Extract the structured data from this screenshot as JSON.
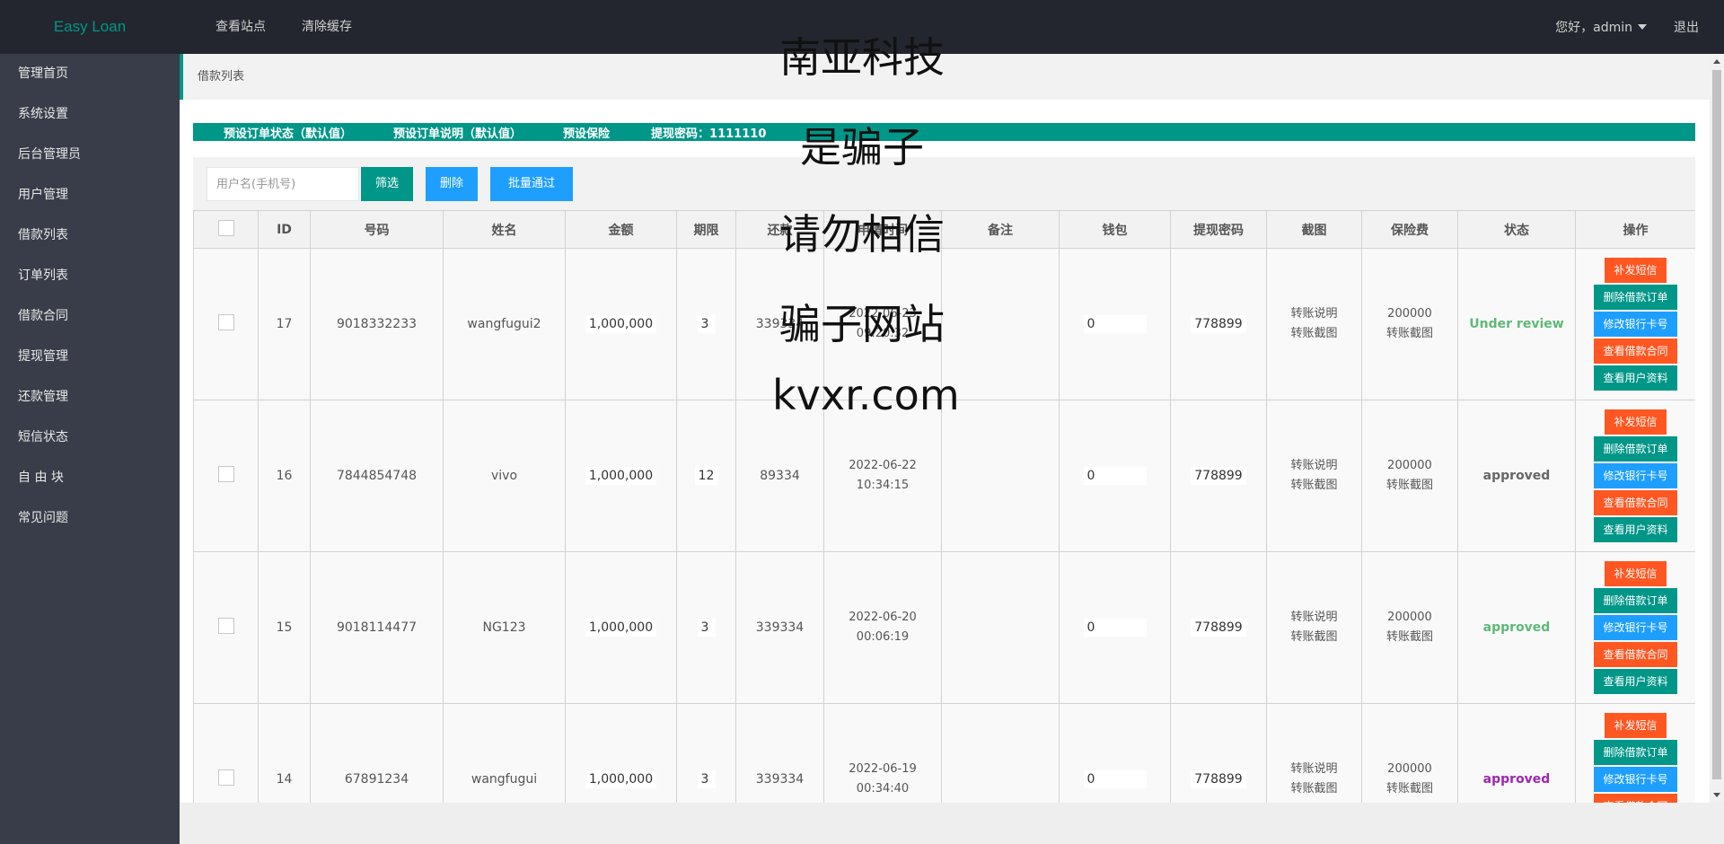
{
  "header": {
    "logo": "Easy Loan",
    "nav": [
      "查看站点",
      "清除缓存"
    ],
    "greeting": "您好，admin",
    "logout": "退出"
  },
  "sidebar": {
    "items": [
      "管理首页",
      "系统设置",
      "后台管理员",
      "用户管理",
      "借款列表",
      "订单列表",
      "借款合同",
      "提现管理",
      "还款管理",
      "短信状态",
      "自 由 块",
      "常见问题"
    ]
  },
  "breadcrumb": "借款列表",
  "notice": {
    "items": [
      "预设订单状态（默认值）",
      "预设订单说明（默认值）",
      "预设保险",
      "提现密码：1111110"
    ]
  },
  "filter": {
    "placeholder": "用户名(手机号)",
    "filter_btn": "筛选",
    "delete_btn": "删除",
    "batch_btn": "批量通过"
  },
  "table": {
    "headers": [
      "",
      "ID",
      "号码",
      "姓名",
      "金额",
      "期限",
      "还款",
      "申请时间",
      "备注",
      "钱包",
      "提现密码",
      "截图",
      "保险费",
      "状态",
      "操作"
    ],
    "rows": [
      {
        "id": "17",
        "phone": "9018332233",
        "name": "wangfugui2",
        "amount": "1,000,000",
        "term": "3",
        "repay": "339334",
        "date": "2022-06-23",
        "time": "09:20:32",
        "note": "",
        "wallet": "0",
        "pwd": "778899",
        "shot1": "转账说明",
        "shot2": "转账截图",
        "fee": "200000",
        "fee2": "转账截图",
        "status": "Under review",
        "status_color": "green"
      },
      {
        "id": "16",
        "phone": "7844854748",
        "name": "vivo",
        "amount": "1,000,000",
        "term": "12",
        "repay": "89334",
        "date": "2022-06-22",
        "time": "10:34:15",
        "note": "",
        "wallet": "0",
        "pwd": "778899",
        "shot1": "转账说明",
        "shot2": "转账截图",
        "fee": "200000",
        "fee2": "转账截图",
        "status": "approved",
        "status_color": "gray"
      },
      {
        "id": "15",
        "phone": "9018114477",
        "name": "NG123",
        "amount": "1,000,000",
        "term": "3",
        "repay": "339334",
        "date": "2022-06-20",
        "time": "00:06:19",
        "note": "",
        "wallet": "0",
        "pwd": "778899",
        "shot1": "转账说明",
        "shot2": "转账截图",
        "fee": "200000",
        "fee2": "转账截图",
        "status": "approved",
        "status_color": "green"
      },
      {
        "id": "14",
        "phone": "67891234",
        "name": "wangfugui",
        "amount": "1,000,000",
        "term": "3",
        "repay": "339334",
        "date": "2022-06-19",
        "time": "00:34:40",
        "note": "",
        "wallet": "0",
        "pwd": "778899",
        "shot1": "转账说明",
        "shot2": "转账截图",
        "fee": "200000",
        "fee2": "转账截图",
        "status": "approved",
        "status_color": "purple"
      }
    ],
    "ops": [
      "补发短信",
      "删除借款订单",
      "修改银行卡号",
      "查看借款合同",
      "查看用户资料"
    ]
  },
  "overlay": [
    "南亚科技",
    "是骗子",
    "请勿相信",
    "骗子网站",
    "kvxr.com"
  ],
  "colors": {
    "accent": "#009688",
    "blue": "#1e9fff",
    "red": "#ff5722",
    "header_bg": "#23262e",
    "sidebar_bg": "#393d49"
  }
}
